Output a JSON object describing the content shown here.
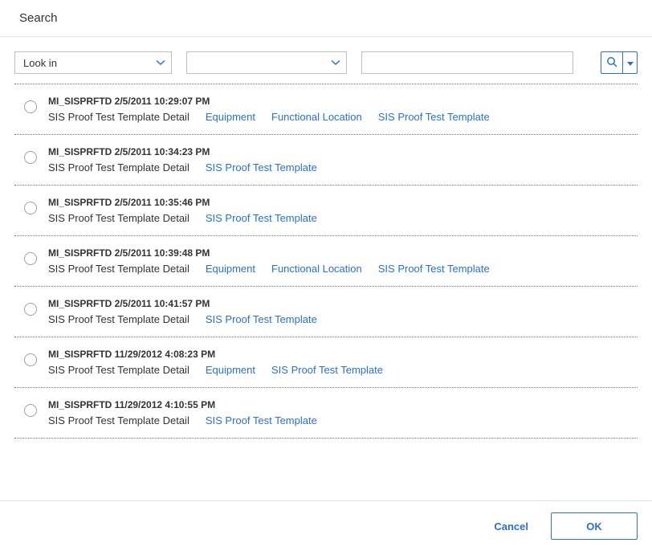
{
  "header": {
    "title": "Search"
  },
  "toolbar": {
    "lookin_label": "Look in",
    "second_value": "",
    "text_value": ""
  },
  "results": [
    {
      "title": "MI_SISPRFTD 2/5/2011 10:29:07 PM",
      "detail": "SIS Proof Test Template Detail",
      "links": [
        "Equipment",
        "Functional Location",
        "SIS Proof Test Template"
      ]
    },
    {
      "title": "MI_SISPRFTD 2/5/2011 10:34:23 PM",
      "detail": "SIS Proof Test Template Detail",
      "links": [
        "SIS Proof Test Template"
      ]
    },
    {
      "title": "MI_SISPRFTD 2/5/2011 10:35:46 PM",
      "detail": "SIS Proof Test Template Detail",
      "links": [
        "SIS Proof Test Template"
      ]
    },
    {
      "title": "MI_SISPRFTD 2/5/2011 10:39:48 PM",
      "detail": "SIS Proof Test Template Detail",
      "links": [
        "Equipment",
        "Functional Location",
        "SIS Proof Test Template"
      ]
    },
    {
      "title": "MI_SISPRFTD 2/5/2011 10:41:57 PM",
      "detail": "SIS Proof Test Template Detail",
      "links": [
        "SIS Proof Test Template"
      ]
    },
    {
      "title": "MI_SISPRFTD 11/29/2012 4:08:23 PM",
      "detail": "SIS Proof Test Template Detail",
      "links": [
        "Equipment",
        "SIS Proof Test Template"
      ]
    },
    {
      "title": "MI_SISPRFTD 11/29/2012 4:10:55 PM",
      "detail": "SIS Proof Test Template Detail",
      "links": [
        "SIS Proof Test Template"
      ]
    }
  ],
  "footer": {
    "cancel_label": "Cancel",
    "ok_label": "OK"
  },
  "colors": {
    "link": "#2a6fd6"
  }
}
